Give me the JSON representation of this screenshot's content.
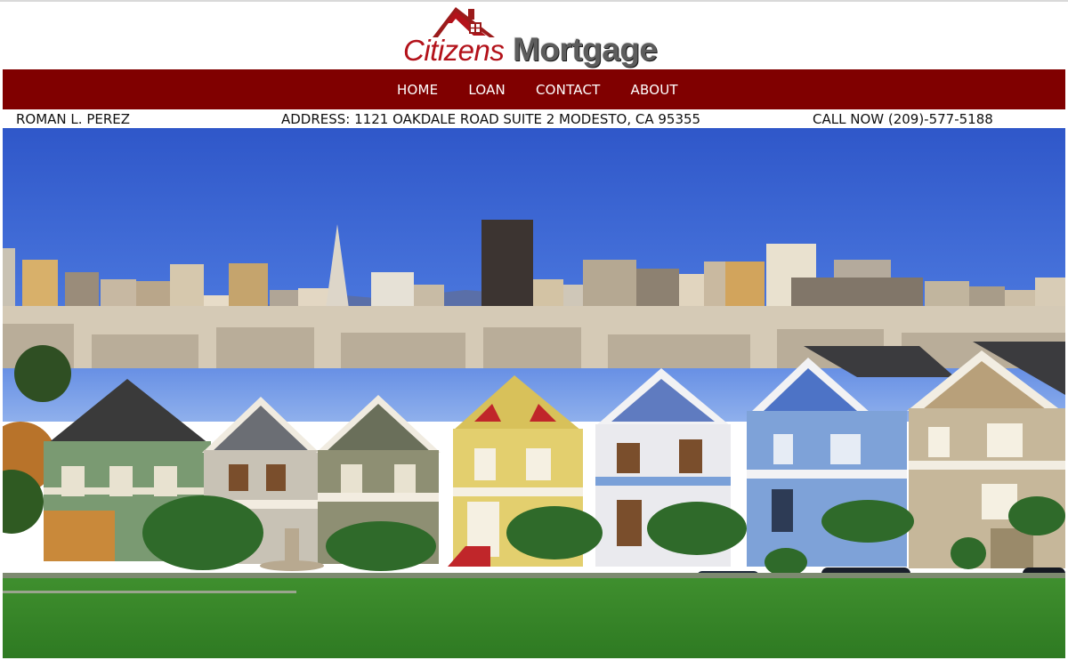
{
  "brand": {
    "logo_word_1": "Citizens",
    "logo_word_2": "Mortgage",
    "accent_color": "#800000",
    "logo_red": "#b3121a"
  },
  "nav": {
    "items": [
      {
        "label": "HOME"
      },
      {
        "label": "LOAN"
      },
      {
        "label": "CONTACT"
      },
      {
        "label": "ABOUT"
      }
    ]
  },
  "info": {
    "name": "ROMAN L. PEREZ",
    "address": "ADDRESS: 1121 OAKDALE ROAD SUITE 2 MODESTO, CA 95355",
    "phone": "CALL NOW (209)-577-5188"
  },
  "hero": {
    "icon": "painted-ladies-skyline-photo"
  }
}
